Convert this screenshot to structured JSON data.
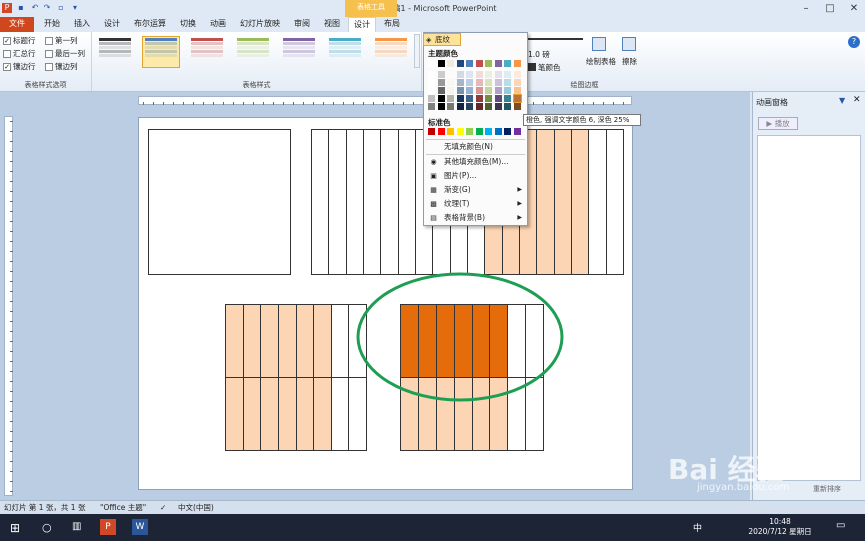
{
  "window": {
    "title": "演示文稿1 - Microsoft PowerPoint",
    "context_tab": "表格工具"
  },
  "tabs": [
    "文件",
    "开始",
    "插入",
    "设计",
    "布尔运算",
    "切换",
    "动画",
    "幻灯片放映",
    "审阅",
    "视图",
    "设计",
    "布局"
  ],
  "ribbon": {
    "style_options": {
      "label": "表格样式选项",
      "items": [
        {
          "label": "标题行",
          "checked": true
        },
        {
          "label": "第一列",
          "checked": false
        },
        {
          "label": "汇总行",
          "checked": false
        },
        {
          "label": "最后一列",
          "checked": false
        },
        {
          "label": "镶边行",
          "checked": true
        },
        {
          "label": "镶边列",
          "checked": false
        }
      ]
    },
    "table_styles": {
      "label": "表格样式",
      "swatches": [
        "#333333",
        "#4f81bd",
        "#c0504d",
        "#9bbb59",
        "#8064a2",
        "#4bacc6",
        "#f79646"
      ]
    },
    "draw_borders": {
      "label": "绘图边框",
      "pen_weight": "1.0 磅",
      "pen_color": "笔颜色",
      "draw_table": "绘制表格",
      "eraser": "擦除"
    },
    "shading_button": "底纹"
  },
  "menu": {
    "theme_header": "主题颜色",
    "standard_header": "标准色",
    "theme_top": [
      "#ffffff",
      "#000000",
      "#eeece1",
      "#1f497d",
      "#4f81bd",
      "#c0504d",
      "#9bbb59",
      "#8064a2",
      "#4bacc6",
      "#f79646"
    ],
    "standard": [
      "#c00000",
      "#ff0000",
      "#ffc000",
      "#ffff00",
      "#92d050",
      "#00b050",
      "#00b0f0",
      "#0070c0",
      "#002060",
      "#7030a0"
    ],
    "items": [
      {
        "label": "无填充颜色(N)",
        "icon": "no-fill-icon",
        "submenu": false
      },
      {
        "label": "其他填充颜色(M)...",
        "icon": "palette-icon",
        "submenu": false
      },
      {
        "label": "图片(P)...",
        "icon": "picture-icon",
        "submenu": false
      },
      {
        "label": "渐变(G)",
        "icon": "gradient-icon",
        "submenu": true
      },
      {
        "label": "纹理(T)",
        "icon": "texture-icon",
        "submenu": true
      },
      {
        "label": "表格背景(B)",
        "icon": "table-background-icon",
        "submenu": true
      }
    ]
  },
  "tooltip": "橙色, 强调文字颜色 6, 深色 25%",
  "pane": {
    "title": "动画窗格",
    "play": "▶ 播放",
    "reorder": "重新排序"
  },
  "status": {
    "slide_info": "幻灯片 第 1 张，共 1 张",
    "theme": "\"Office 主题\"",
    "language": "中文(中国)"
  },
  "taskbar": {
    "time": "10:48",
    "date": "2020/7/12 星期日",
    "ime": "中"
  },
  "watermark": {
    "text": "Bai 经验",
    "sub": "jingyan.baidu.com"
  },
  "colors": {
    "peach": "#fcd5b4",
    "orange": "#e46c0a",
    "ellipse": "#1e9e52"
  }
}
